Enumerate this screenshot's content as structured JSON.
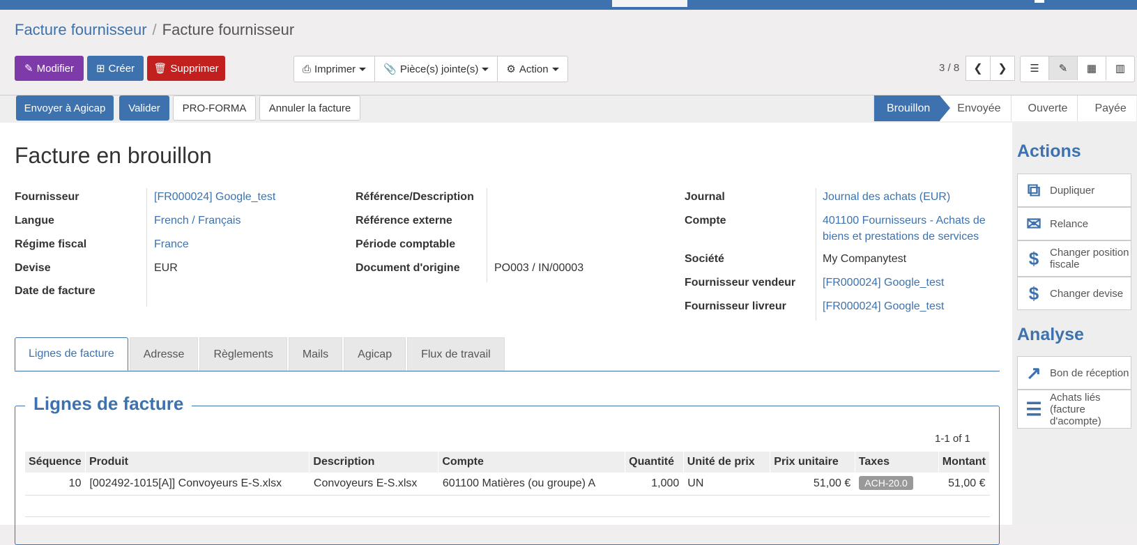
{
  "breadcrumb": {
    "parent": "Facture fournisseur",
    "current": "Facture fournisseur"
  },
  "toolbar": {
    "edit": "Modifier",
    "create": "Créer",
    "delete": "Supprimer",
    "print": "Imprimer",
    "attachments": "Pièce(s) jointe(s)",
    "action": "Action",
    "pager": "3 / 8"
  },
  "statusbar": {
    "send_agicap": "Envoyer à Agicap",
    "validate": "Valider",
    "proforma": "PRO-FORMA",
    "cancel": "Annuler la facture",
    "stages": [
      "Brouillon",
      "Envoyée",
      "Ouverte",
      "Payée"
    ],
    "active_stage": "Brouillon"
  },
  "form": {
    "title": "Facture en brouillon",
    "col1": [
      {
        "label": "Fournisseur",
        "value": "[FR000024] Google_test"
      },
      {
        "label": "Langue",
        "value": "French / Français"
      },
      {
        "label": "Régime fiscal",
        "value": "France"
      },
      {
        "label": "Devise",
        "value": "EUR"
      },
      {
        "label": "Date de facture",
        "value": ""
      }
    ],
    "col2": [
      {
        "label": "Référence/Description",
        "value": ""
      },
      {
        "label": "Référence externe",
        "value": ""
      },
      {
        "label": "Période comptable",
        "value": ""
      },
      {
        "label": "Document d'origine",
        "value": "PO003 / IN/00003"
      }
    ],
    "col3": [
      {
        "label": "Journal",
        "value": "Journal des achats (EUR)"
      },
      {
        "label": "Compte",
        "value_line1": "401100 Fournisseurs - Achats de",
        "value_line2": "biens et prestations de services"
      },
      {
        "label": "Société",
        "value": "My Companytest"
      },
      {
        "label": "Fournisseur vendeur",
        "value": "[FR000024] Google_test"
      },
      {
        "label": "Fournisseur livreur",
        "value": "[FR000024] Google_test"
      }
    ]
  },
  "tabs": [
    "Lignes de facture",
    "Adresse",
    "Règlements",
    "Mails",
    "Agicap",
    "Flux de travail"
  ],
  "lines": {
    "legend": "Lignes de facture",
    "pager": "1-1 of 1",
    "columns": [
      "Séquence",
      "Produit",
      "Description",
      "Compte",
      "Quantité",
      "Unité de prix",
      "Prix unitaire",
      "Taxes",
      "Montant"
    ],
    "rows": [
      [
        "10",
        "[002492-1015[A]] Convoyeurs E-S.xlsx",
        "Convoyeurs E-S.xlsx",
        "601100 Matières (ou groupe) A",
        "1,000",
        "UN",
        "51,00 €",
        "ACH-20.0",
        "51,00 €"
      ]
    ]
  },
  "sidebar": {
    "actions_title": "Actions",
    "actions": [
      "Dupliquer",
      "Relance",
      "Changer position fiscale",
      "Changer devise"
    ],
    "analysis_title": "Analyse",
    "analysis": [
      "Bon de réception",
      "Achats liés (facture d'acompte)"
    ]
  },
  "colors": {
    "primary": "#3d72ae",
    "purple": "#7d3aa8",
    "danger": "#c21f1f"
  }
}
